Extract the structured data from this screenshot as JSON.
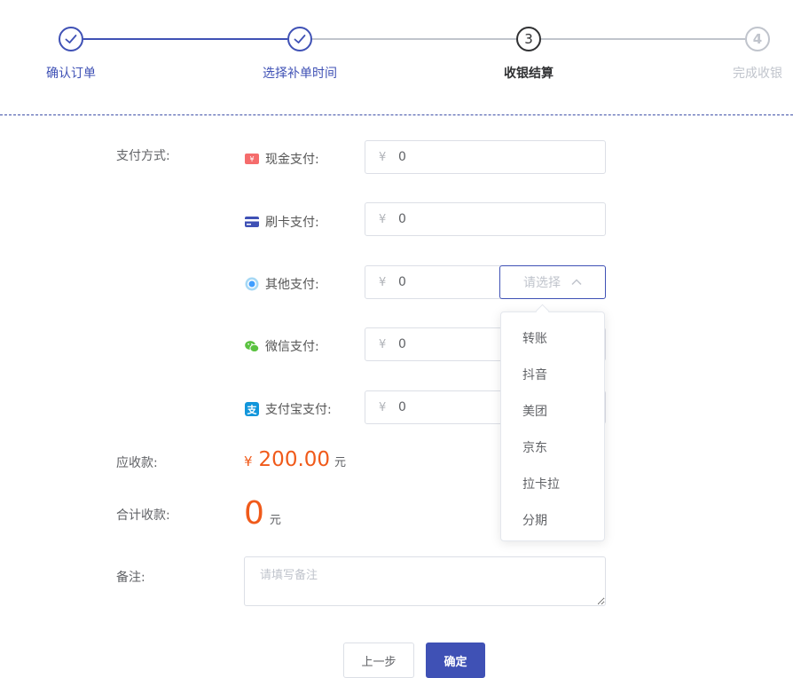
{
  "colors": {
    "accent": "#3f51b5",
    "amount": "#f05a1a",
    "done_step": "#3f51b5",
    "pending_step": "#c0c4cc"
  },
  "steps": [
    {
      "number": "✓",
      "label": "确认订单",
      "status": "done"
    },
    {
      "number": "✓",
      "label": "选择补单时间",
      "status": "done"
    },
    {
      "number": "3",
      "label": "收银结算",
      "status": "current"
    },
    {
      "number": "4",
      "label": "完成收银",
      "status": "pending"
    }
  ],
  "form": {
    "payment_method_label": "支付方式:",
    "currency_symbol": "¥",
    "payments": {
      "cash": {
        "label": "现金支付:",
        "value": "0",
        "icon": "cash-icon"
      },
      "card": {
        "label": "刷卡支付:",
        "value": "0",
        "icon": "card-icon"
      },
      "other": {
        "label": "其他支付:",
        "value": "0",
        "icon": "other-pay-icon"
      },
      "wechat": {
        "label": "微信支付:",
        "value": "0",
        "icon": "wechat-icon"
      },
      "alipay": {
        "label": "支付宝支付:",
        "value": "0",
        "icon": "alipay-icon"
      }
    },
    "other_select": {
      "placeholder": "请选择",
      "options": [
        "转账",
        "抖音",
        "美团",
        "京东",
        "拉卡拉",
        "分期"
      ]
    },
    "due_label": "应收款:",
    "due_symbol": "¥",
    "due_amount": "200.00",
    "due_unit": "元",
    "total_label": "合计收款:",
    "total_amount": "0",
    "total_unit": "元",
    "remark_label": "备注:",
    "remark_placeholder": "请填写备注"
  },
  "buttons": {
    "prev": "上一步",
    "confirm": "确定"
  }
}
